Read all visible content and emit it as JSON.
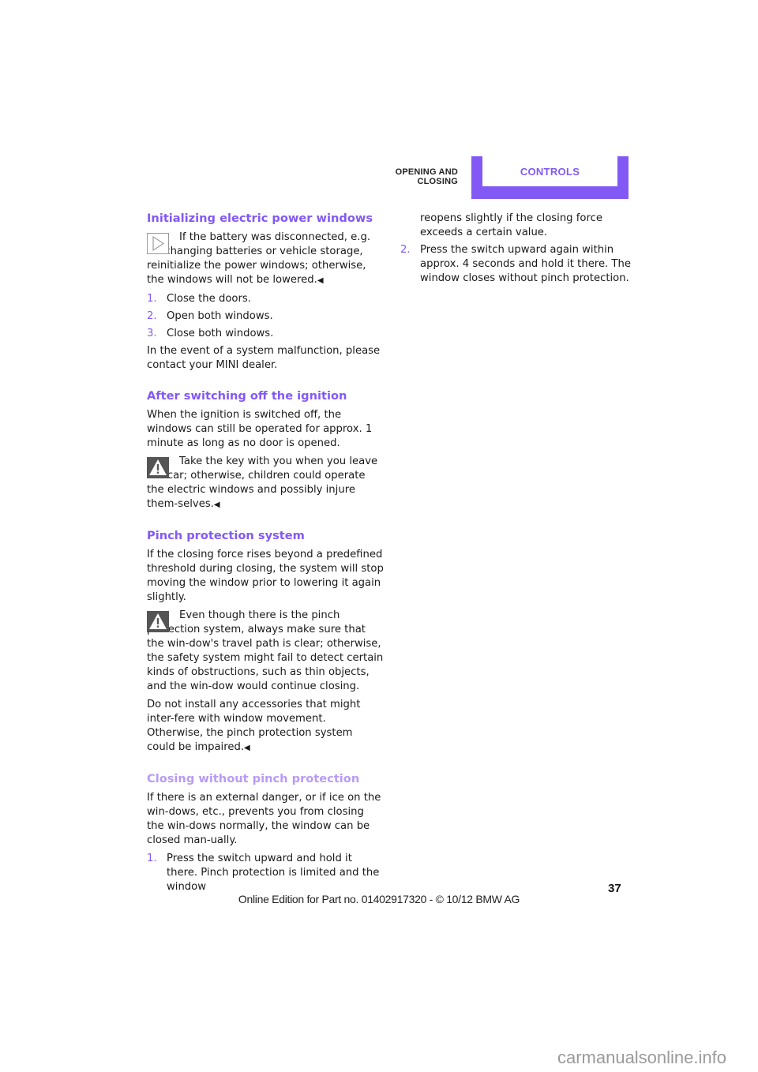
{
  "header": {
    "section": "OPENING AND CLOSING",
    "tab": "CONTROLS",
    "accent_color": "#8259f5"
  },
  "left": {
    "s1": {
      "title": "Initializing electric power windows",
      "note_icon": "arrow-right-icon",
      "note": "If the battery was disconnected, e.g. for changing batteries or vehicle storage, reinitialize the power windows; otherwise, the windows will not be lowered.",
      "end_mark": "◀",
      "steps": [
        {
          "num": "1.",
          "text": "Close the doors."
        },
        {
          "num": "2.",
          "text": "Open both windows."
        },
        {
          "num": "3.",
          "text": "Close both windows."
        }
      ],
      "para": "In the event of a system malfunction, please contact your MINI dealer."
    },
    "s2": {
      "title": "After switching off the ignition",
      "para": "When the ignition is switched off, the windows can still be operated for approx. 1 minute as long as no door is opened.",
      "warning_icon": "warning-icon",
      "warning": "Take the key with you when you leave the car; otherwise, children could operate the electric windows and possibly injure them-selves.",
      "end_mark": "◀"
    },
    "s3": {
      "title": "Pinch protection system",
      "para": "If the closing force rises beyond a predefined threshold during closing, the system will stop moving the window prior to lowering it again slightly.",
      "warning_icon": "warning-icon",
      "warning": "Even though there is the pinch protection system, always make sure that the win-dow's travel path is clear; otherwise, the safety system might fail to detect certain kinds of obstructions, such as thin objects, and the win-dow would continue closing.",
      "para2": "Do not install any accessories that might inter-fere with window movement. Otherwise, the pinch protection system could be impaired.",
      "end_mark": "◀"
    },
    "s4": {
      "title": "Closing without pinch protection",
      "para": "If there is an external danger, or if ice on the win-dows, etc., prevents you from closing the win-dows normally, the window can be closed man-ually.",
      "step1_num": "1.",
      "step1_text": "Press the switch upward and hold it there. Pinch protection is limited and the window"
    }
  },
  "right": {
    "continued": "reopens slightly if the closing force exceeds a certain value.",
    "step2_num": "2.",
    "step2_text": "Press the switch upward again within approx. 4 seconds and hold it there. The window closes without pinch protection."
  },
  "footer": {
    "page_number": "37",
    "edition": "Online Edition for Part no. 01402917320 - © 10/12 BMW AG",
    "watermark": "carmanualsonline.info"
  }
}
